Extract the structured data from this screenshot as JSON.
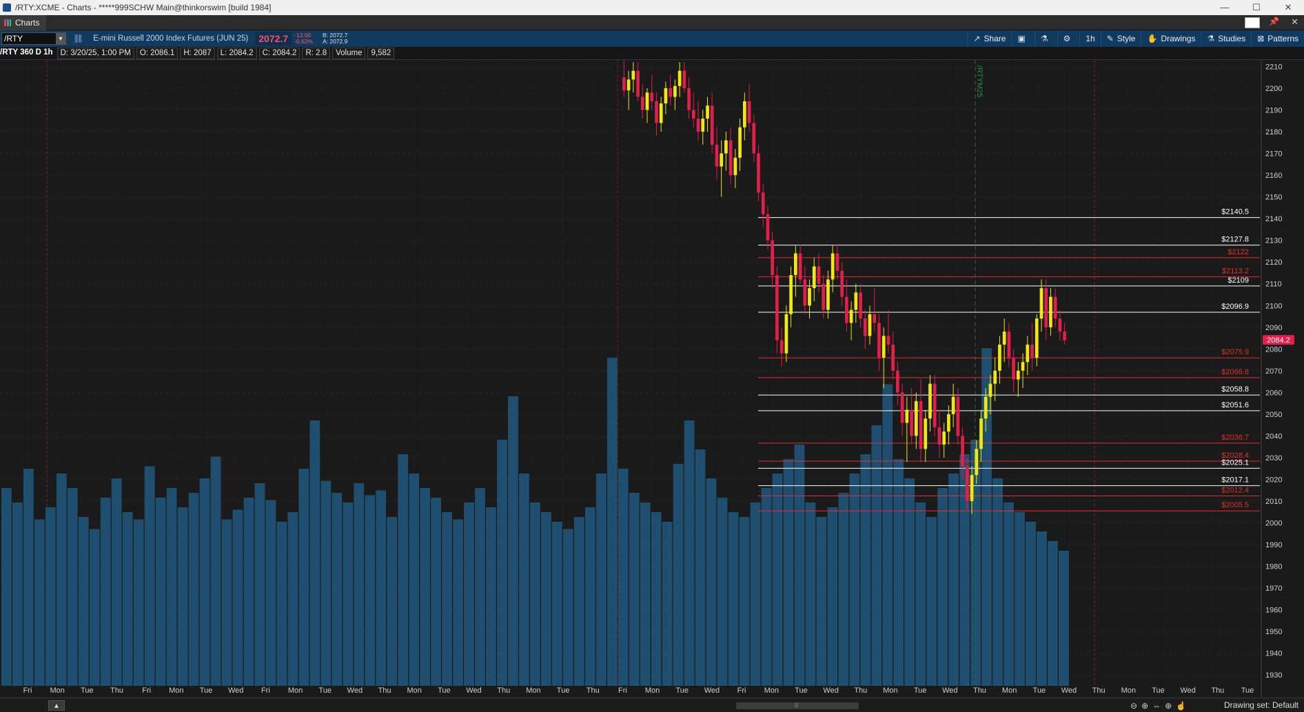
{
  "window": {
    "title": "/RTY:XCME - Charts - *****999SCHW Main@thinkorswim [build 1984]",
    "controls": [
      "—",
      "☐",
      "✕"
    ]
  },
  "tab": {
    "label": "Charts"
  },
  "toolbar": {
    "symbol": "/RTY",
    "description": "E-mini Russell 2000 Index Futures (JUN 25)",
    "last": "2072.7",
    "change": "-13.00",
    "change_pct": "-0.62%",
    "bid": "B: 2072.7",
    "ask": "A: 2072.9",
    "buttons": {
      "share": "Share",
      "timeframe": "1h",
      "style": "Style",
      "drawings": "Drawings",
      "studies": "Studies",
      "patterns": "Patterns"
    }
  },
  "infobar": {
    "name": "/RTY 360 D 1h",
    "date": "D: 3/20/25, 1:00 PM",
    "open": "O: 2086.1",
    "high": "H: 2087",
    "low": "L: 2084.2",
    "close": "C: 2084.2",
    "range": "R: 2.8",
    "volume_label": "Volume",
    "volume": "9,582"
  },
  "chart_data": {
    "type": "candlestick",
    "price_axis": {
      "min": 1925,
      "max": 2213,
      "ticks": [
        2210,
        2200,
        2190,
        2180,
        2170,
        2160,
        2150,
        2140,
        2130,
        2120,
        2110,
        2100,
        2090,
        2080,
        2070,
        2060,
        2050,
        2040,
        2030,
        2020,
        2010,
        2000,
        1990,
        1980,
        1970,
        1960,
        1950,
        1940,
        1930
      ]
    },
    "current_price": "2084.2",
    "levels": [
      {
        "label": "$2140.5",
        "price": 2140.5,
        "color": "#ffffff"
      },
      {
        "label": "$2127.8",
        "price": 2127.8,
        "color": "#ffffff"
      },
      {
        "label": "$2122",
        "price": 2122,
        "color": "#e03030"
      },
      {
        "label": "$2113.2",
        "price": 2113.2,
        "color": "#e03030"
      },
      {
        "label": "$2109",
        "price": 2109,
        "color": "#ffffff"
      },
      {
        "label": "$2096.9",
        "price": 2096.9,
        "color": "#ffffff"
      },
      {
        "label": "$2075.9",
        "price": 2075.9,
        "color": "#e03030"
      },
      {
        "label": "$2066.8",
        "price": 2066.8,
        "color": "#e03030"
      },
      {
        "label": "$2058.8",
        "price": 2058.8,
        "color": "#ffffff"
      },
      {
        "label": "$2051.6",
        "price": 2051.6,
        "color": "#ffffff"
      },
      {
        "label": "$2036.7",
        "price": 2036.7,
        "color": "#e03030"
      },
      {
        "label": "$2028.4",
        "price": 2028.4,
        "color": "#e03030"
      },
      {
        "label": "$2025.1",
        "price": 2025.1,
        "color": "#ffffff"
      },
      {
        "label": "$2017.1",
        "price": 2017.1,
        "color": "#ffffff"
      },
      {
        "label": "$2012.4",
        "price": 2012.4,
        "color": "#e03030"
      },
      {
        "label": "$2005.5",
        "price": 2005.5,
        "color": "#e03030"
      }
    ],
    "x_labels": [
      "Fri",
      "Mon",
      "Tue",
      "Thu",
      "Fri",
      "Mon",
      "Tue",
      "Wed",
      "Fri",
      "Mon",
      "Tue",
      "Wed",
      "Thu",
      "Mon",
      "Tue",
      "Wed",
      "Thu",
      "Mon",
      "Tue",
      "Thu",
      "Fri",
      "Mon",
      "Tue",
      "Wed",
      "Fri",
      "Mon",
      "Tue",
      "Wed",
      "Thu",
      "Mon",
      "Tue",
      "Wed",
      "Thu",
      "Mon",
      "Tue",
      "Wed",
      "Thu",
      "Mon",
      "Tue",
      "Wed",
      "Thu",
      "Tue"
    ],
    "expiry_marker": "/RTYM25",
    "candles": [
      {
        "o": 2205,
        "h": 2215,
        "l": 2196,
        "c": 2199
      },
      {
        "o": 2199,
        "h": 2208,
        "l": 2190,
        "c": 2204
      },
      {
        "o": 2204,
        "h": 2212,
        "l": 2198,
        "c": 2208
      },
      {
        "o": 2208,
        "h": 2212,
        "l": 2194,
        "c": 2196
      },
      {
        "o": 2196,
        "h": 2202,
        "l": 2186,
        "c": 2190
      },
      {
        "o": 2190,
        "h": 2200,
        "l": 2184,
        "c": 2198
      },
      {
        "o": 2198,
        "h": 2206,
        "l": 2190,
        "c": 2194
      },
      {
        "o": 2194,
        "h": 2198,
        "l": 2178,
        "c": 2184
      },
      {
        "o": 2184,
        "h": 2196,
        "l": 2180,
        "c": 2193
      },
      {
        "o": 2193,
        "h": 2203,
        "l": 2188,
        "c": 2200
      },
      {
        "o": 2200,
        "h": 2206,
        "l": 2192,
        "c": 2196
      },
      {
        "o": 2196,
        "h": 2204,
        "l": 2190,
        "c": 2201
      },
      {
        "o": 2201,
        "h": 2212,
        "l": 2196,
        "c": 2208
      },
      {
        "o": 2208,
        "h": 2212,
        "l": 2198,
        "c": 2200
      },
      {
        "o": 2200,
        "h": 2205,
        "l": 2186,
        "c": 2190
      },
      {
        "o": 2190,
        "h": 2198,
        "l": 2182,
        "c": 2186
      },
      {
        "o": 2186,
        "h": 2194,
        "l": 2176,
        "c": 2180
      },
      {
        "o": 2180,
        "h": 2190,
        "l": 2174,
        "c": 2186
      },
      {
        "o": 2186,
        "h": 2196,
        "l": 2180,
        "c": 2192
      },
      {
        "o": 2192,
        "h": 2198,
        "l": 2170,
        "c": 2174
      },
      {
        "o": 2174,
        "h": 2182,
        "l": 2158,
        "c": 2164
      },
      {
        "o": 2164,
        "h": 2176,
        "l": 2150,
        "c": 2170
      },
      {
        "o": 2170,
        "h": 2180,
        "l": 2162,
        "c": 2176
      },
      {
        "o": 2176,
        "h": 2182,
        "l": 2156,
        "c": 2160
      },
      {
        "o": 2160,
        "h": 2172,
        "l": 2154,
        "c": 2168
      },
      {
        "o": 2168,
        "h": 2186,
        "l": 2162,
        "c": 2182
      },
      {
        "o": 2182,
        "h": 2198,
        "l": 2176,
        "c": 2194
      },
      {
        "o": 2194,
        "h": 2202,
        "l": 2180,
        "c": 2184
      },
      {
        "o": 2184,
        "h": 2188,
        "l": 2166,
        "c": 2170
      },
      {
        "o": 2170,
        "h": 2174,
        "l": 2148,
        "c": 2152
      },
      {
        "o": 2152,
        "h": 2156,
        "l": 2136,
        "c": 2142
      },
      {
        "o": 2142,
        "h": 2146,
        "l": 2126,
        "c": 2130
      },
      {
        "o": 2130,
        "h": 2134,
        "l": 2108,
        "c": 2114
      },
      {
        "o": 2114,
        "h": 2118,
        "l": 2078,
        "c": 2084
      },
      {
        "o": 2084,
        "h": 2090,
        "l": 2072,
        "c": 2078
      },
      {
        "o": 2078,
        "h": 2100,
        "l": 2074,
        "c": 2096
      },
      {
        "o": 2096,
        "h": 2118,
        "l": 2090,
        "c": 2114
      },
      {
        "o": 2114,
        "h": 2128,
        "l": 2104,
        "c": 2124
      },
      {
        "o": 2124,
        "h": 2128,
        "l": 2110,
        "c": 2112
      },
      {
        "o": 2112,
        "h": 2118,
        "l": 2096,
        "c": 2100
      },
      {
        "o": 2100,
        "h": 2112,
        "l": 2094,
        "c": 2108
      },
      {
        "o": 2108,
        "h": 2122,
        "l": 2102,
        "c": 2118
      },
      {
        "o": 2118,
        "h": 2124,
        "l": 2106,
        "c": 2110
      },
      {
        "o": 2110,
        "h": 2114,
        "l": 2094,
        "c": 2098
      },
      {
        "o": 2098,
        "h": 2116,
        "l": 2094,
        "c": 2112
      },
      {
        "o": 2112,
        "h": 2128,
        "l": 2106,
        "c": 2124
      },
      {
        "o": 2124,
        "h": 2128,
        "l": 2112,
        "c": 2116
      },
      {
        "o": 2116,
        "h": 2120,
        "l": 2100,
        "c": 2104
      },
      {
        "o": 2104,
        "h": 2112,
        "l": 2088,
        "c": 2092
      },
      {
        "o": 2092,
        "h": 2102,
        "l": 2084,
        "c": 2098
      },
      {
        "o": 2098,
        "h": 2110,
        "l": 2092,
        "c": 2106
      },
      {
        "o": 2106,
        "h": 2110,
        "l": 2090,
        "c": 2094
      },
      {
        "o": 2094,
        "h": 2098,
        "l": 2080,
        "c": 2086
      },
      {
        "o": 2086,
        "h": 2100,
        "l": 2082,
        "c": 2096
      },
      {
        "o": 2096,
        "h": 2108,
        "l": 2088,
        "c": 2092
      },
      {
        "o": 2092,
        "h": 2096,
        "l": 2070,
        "c": 2076
      },
      {
        "o": 2076,
        "h": 2090,
        "l": 2062,
        "c": 2086
      },
      {
        "o": 2086,
        "h": 2098,
        "l": 2078,
        "c": 2082
      },
      {
        "o": 2082,
        "h": 2088,
        "l": 2066,
        "c": 2070
      },
      {
        "o": 2070,
        "h": 2074,
        "l": 2054,
        "c": 2060
      },
      {
        "o": 2060,
        "h": 2064,
        "l": 2040,
        "c": 2046
      },
      {
        "o": 2046,
        "h": 2058,
        "l": 2028,
        "c": 2052
      },
      {
        "o": 2052,
        "h": 2062,
        "l": 2036,
        "c": 2040
      },
      {
        "o": 2040,
        "h": 2060,
        "l": 2034,
        "c": 2056
      },
      {
        "o": 2056,
        "h": 2066,
        "l": 2028,
        "c": 2034
      },
      {
        "o": 2034,
        "h": 2052,
        "l": 2028,
        "c": 2048
      },
      {
        "o": 2048,
        "h": 2068,
        "l": 2042,
        "c": 2064
      },
      {
        "o": 2064,
        "h": 2068,
        "l": 2040,
        "c": 2044
      },
      {
        "o": 2044,
        "h": 2052,
        "l": 2030,
        "c": 2036
      },
      {
        "o": 2036,
        "h": 2046,
        "l": 2030,
        "c": 2042
      },
      {
        "o": 2042,
        "h": 2054,
        "l": 2036,
        "c": 2050
      },
      {
        "o": 2050,
        "h": 2064,
        "l": 2044,
        "c": 2058
      },
      {
        "o": 2058,
        "h": 2062,
        "l": 2036,
        "c": 2040
      },
      {
        "o": 2040,
        "h": 2044,
        "l": 2020,
        "c": 2026
      },
      {
        "o": 2026,
        "h": 2030,
        "l": 2006,
        "c": 2010
      },
      {
        "o": 2010,
        "h": 2026,
        "l": 2004,
        "c": 2022
      },
      {
        "o": 2022,
        "h": 2038,
        "l": 2018,
        "c": 2034
      },
      {
        "o": 2034,
        "h": 2052,
        "l": 2028,
        "c": 2048
      },
      {
        "o": 2048,
        "h": 2062,
        "l": 2042,
        "c": 2058
      },
      {
        "o": 2058,
        "h": 2068,
        "l": 2050,
        "c": 2064
      },
      {
        "o": 2064,
        "h": 2076,
        "l": 2056,
        "c": 2070
      },
      {
        "o": 2070,
        "h": 2086,
        "l": 2064,
        "c": 2082
      },
      {
        "o": 2082,
        "h": 2094,
        "l": 2074,
        "c": 2088
      },
      {
        "o": 2088,
        "h": 2092,
        "l": 2072,
        "c": 2076
      },
      {
        "o": 2076,
        "h": 2080,
        "l": 2060,
        "c": 2066
      },
      {
        "o": 2066,
        "h": 2074,
        "l": 2058,
        "c": 2070
      },
      {
        "o": 2070,
        "h": 2078,
        "l": 2062,
        "c": 2074
      },
      {
        "o": 2074,
        "h": 2086,
        "l": 2068,
        "c": 2082
      },
      {
        "o": 2082,
        "h": 2092,
        "l": 2070,
        "c": 2076
      },
      {
        "o": 2076,
        "h": 2096,
        "l": 2072,
        "c": 2094
      },
      {
        "o": 2094,
        "h": 2112,
        "l": 2088,
        "c": 2108
      },
      {
        "o": 2108,
        "h": 2112,
        "l": 2084,
        "c": 2090
      },
      {
        "o": 2090,
        "h": 2108,
        "l": 2086,
        "c": 2104
      },
      {
        "o": 2104,
        "h": 2108,
        "l": 2090,
        "c": 2094
      },
      {
        "o": 2094,
        "h": 2098,
        "l": 2084,
        "c": 2088
      },
      {
        "o": 2088,
        "h": 2092,
        "l": 2082,
        "c": 2084
      }
    ],
    "volumes": [
      820,
      760,
      900,
      690,
      740,
      880,
      820,
      700,
      650,
      780,
      860,
      720,
      690,
      910,
      780,
      820,
      740,
      800,
      860,
      950,
      690,
      730,
      780,
      840,
      770,
      680,
      720,
      900,
      1100,
      850,
      800,
      760,
      840,
      790,
      810,
      700,
      960,
      880,
      820,
      780,
      720,
      690,
      760,
      820,
      740,
      1020,
      1200,
      880,
      760,
      720,
      680,
      650,
      700,
      740,
      880,
      1360,
      900,
      800,
      760,
      720,
      680,
      920,
      1100,
      980,
      860,
      780,
      720,
      700,
      760,
      820,
      880,
      940,
      1000,
      760,
      700,
      740,
      800,
      880,
      960,
      1080,
      1250,
      940,
      860,
      760,
      700,
      820,
      880,
      960,
      1020,
      1400,
      860,
      760,
      720,
      680,
      640,
      600,
      560
    ]
  },
  "bottombar": {
    "drawing_set": "Drawing set: Default"
  }
}
